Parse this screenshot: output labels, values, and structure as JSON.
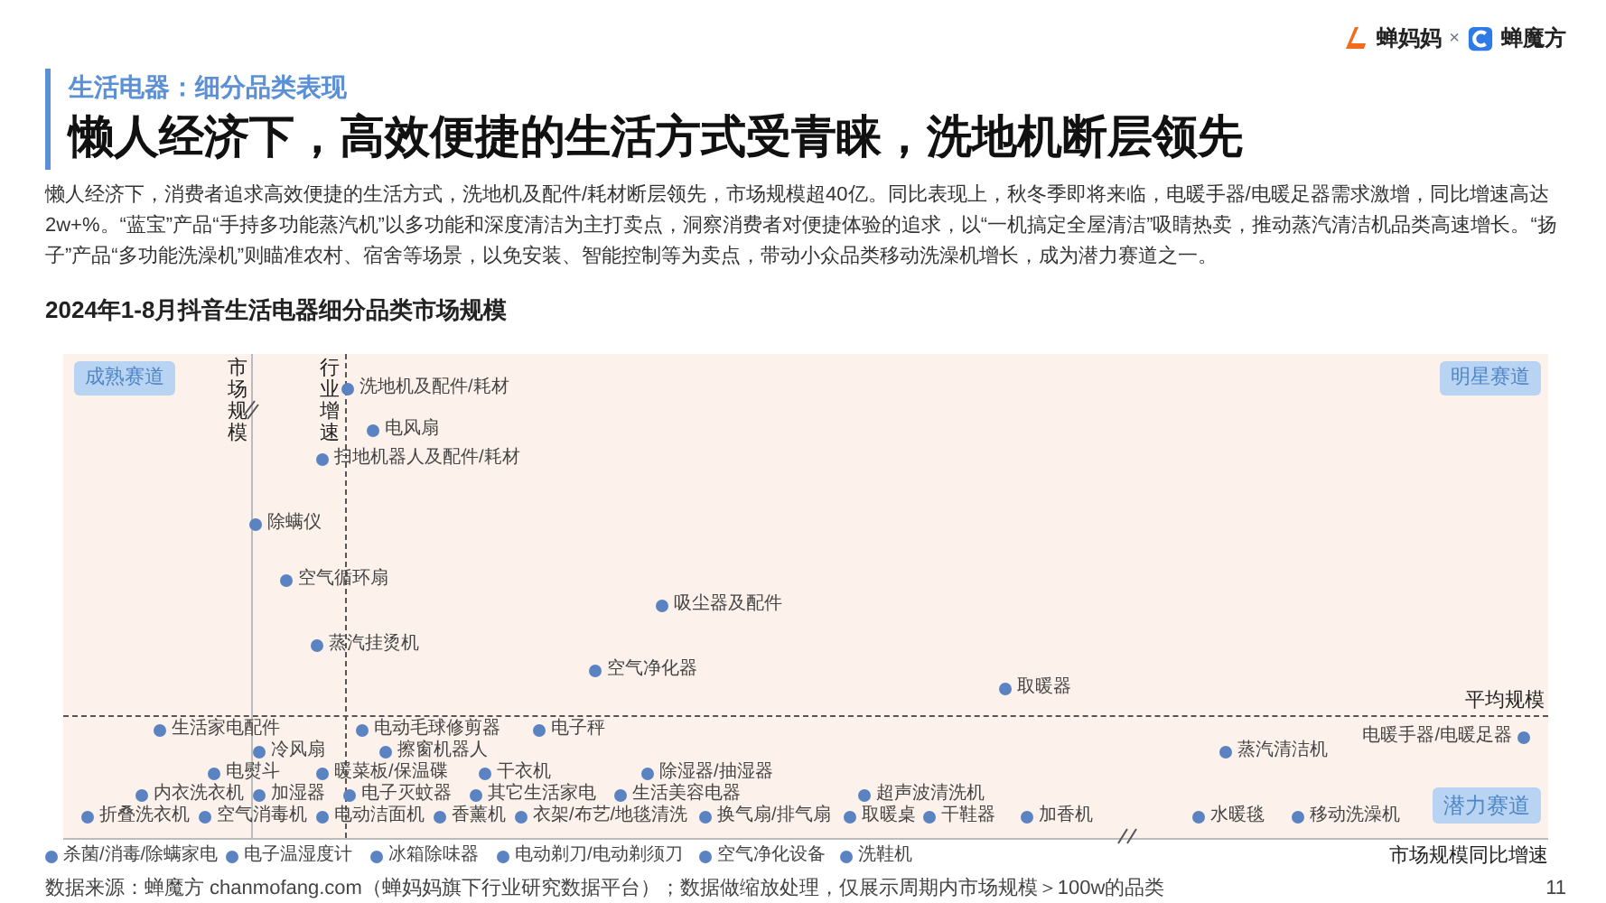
{
  "header": {
    "brand_left": "蝉妈妈",
    "separator": "×",
    "brand_right": "蝉魔方"
  },
  "section_label": "生活电器：细分品类表现",
  "title": "懒人经济下，高效便捷的生活方式受青睐，洗地机断层领先",
  "paragraph": "懒人经济下，消费者追求高效便捷的生活方式，洗地机及配件/耗材断层领先，市场规模超40亿。同比表现上，秋冬季即将来临，电暖手器/电暖足器需求激增，同比增速高达2w+%。“蓝宝”产品“手持多功能蒸汽机”以多功能和深度清洁为主打卖点，洞察消费者对便捷体验的追求，以“一机搞定全屋清洁”吸睛热卖，推动蒸汽清洁机品类高速增长。“扬子”产品“多功能洗澡机”则瞄准农村、宿舍等场景，以免安装、智能控制等为卖点，带动小众品类移动洗澡机增长，成为潜力赛道之一。",
  "chart": {
    "title": "2024年1-8月抖音生活电器细分品类市场规模",
    "quadrant_labels": [
      "成熟赛道",
      "明星赛道",
      "潜力赛道"
    ],
    "y_axis_label": "市场规模",
    "growth_line_label": "行业增速",
    "average_label": "平均规模",
    "x_axis_label": "市场规模同比增速",
    "points": [
      {
        "label": "洗地机及配件/耗材"
      },
      {
        "label": "电风扇"
      },
      {
        "label": "扫地机器人及配件/耗材"
      },
      {
        "label": "除螨仪"
      },
      {
        "label": "空气循环扇"
      },
      {
        "label": "蒸汽挂烫机"
      },
      {
        "label": "吸尘器及配件"
      },
      {
        "label": "空气净化器"
      },
      {
        "label": "取暖器"
      },
      {
        "label": "生活家电配件"
      },
      {
        "label": "电动毛球修剪器"
      },
      {
        "label": "电子秤"
      },
      {
        "label": "电暖手器/电暖足器"
      },
      {
        "label": "冷风扇"
      },
      {
        "label": "擦窗机器人"
      },
      {
        "label": "蒸汽清洁机"
      },
      {
        "label": "电熨斗"
      },
      {
        "label": "暖菜板/保温碟"
      },
      {
        "label": "干衣机"
      },
      {
        "label": "除湿器/抽湿器"
      },
      {
        "label": "内衣洗衣机"
      },
      {
        "label": "加湿器"
      },
      {
        "label": "电子灭蚊器"
      },
      {
        "label": "其它生活家电"
      },
      {
        "label": "生活美容电器"
      },
      {
        "label": "超声波清洗机"
      },
      {
        "label": "折叠洗衣机"
      },
      {
        "label": "空气消毒机"
      },
      {
        "label": "电动洁面机"
      },
      {
        "label": "香薰机"
      },
      {
        "label": "衣架/布艺/地毯清洗"
      },
      {
        "label": "换气扇/排气扇"
      },
      {
        "label": "取暖桌"
      },
      {
        "label": "干鞋器"
      },
      {
        "label": "加香机"
      },
      {
        "label": "水暖毯"
      },
      {
        "label": "移动洗澡机"
      },
      {
        "label": "杀菌/消毒/除螨家电"
      },
      {
        "label": "电子温湿度计"
      },
      {
        "label": "冰箱除味器"
      },
      {
        "label": "电动剃刀/电动剃须刀"
      },
      {
        "label": "空气净化设备"
      },
      {
        "label": "洗鞋机"
      }
    ]
  },
  "footer": {
    "source": "数据来源：蝉魔方 chanmofang.com（蝉妈妈旗下行业研究数据平台）；数据做缩放处理，仅展示周期内市场规模＞100w的品类",
    "page_number": "11"
  }
}
